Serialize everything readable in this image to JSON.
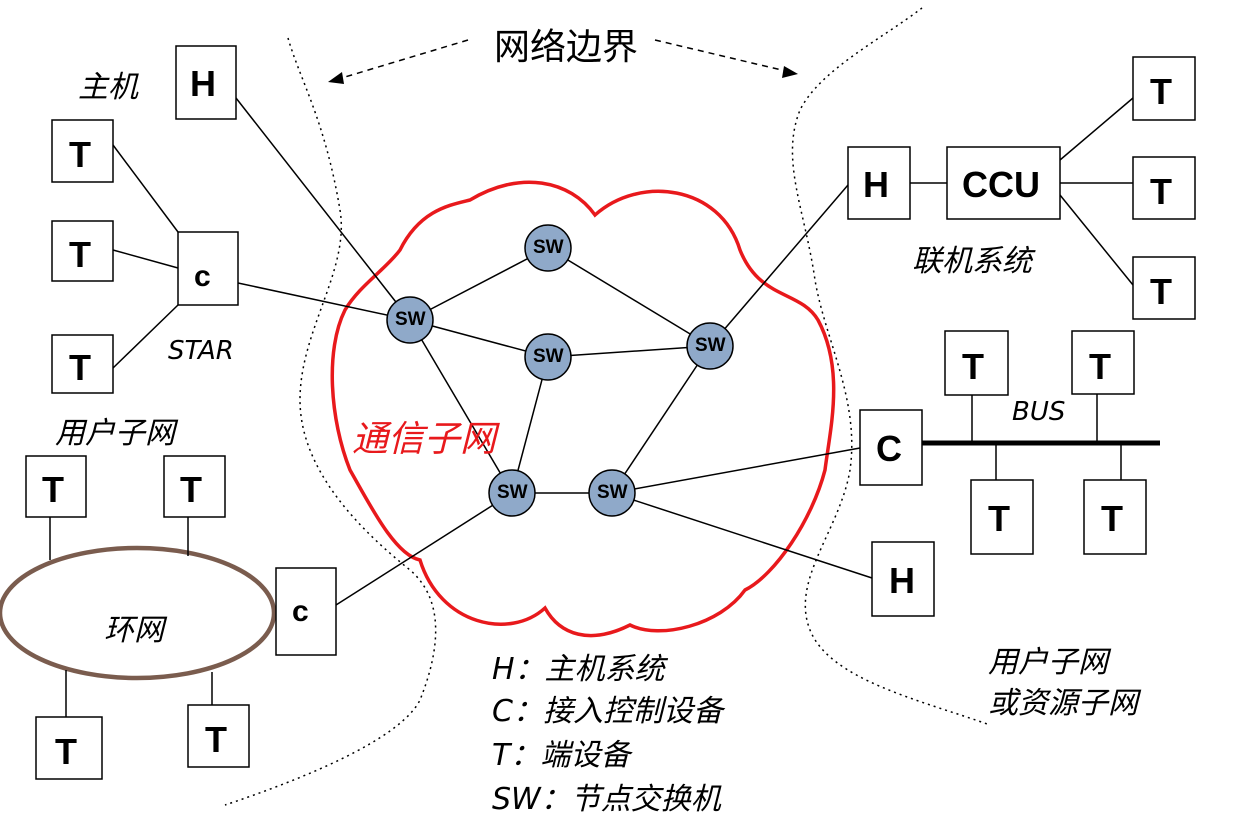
{
  "title": "网络边界",
  "labels": {
    "host_label": "主机",
    "star": "STAR",
    "user_subnet_left": "用户子网",
    "comm_subnet": "通信子网",
    "ring_label": "环网",
    "online_system": "联机系统",
    "bus": "BUS",
    "user_subnet_right_1": "用户子网",
    "user_subnet_right_2": "或资源子网"
  },
  "legend": [
    "H：主机系统",
    "C：接入控制设备",
    "T：端设备",
    "SW：节点交换机"
  ],
  "nodes": {
    "H": "H",
    "T": "T",
    "C": "C",
    "c": "c",
    "CCU": "CCU",
    "SW": "SW"
  },
  "colors": {
    "comm_subnet_border": "#e8191c",
    "switch_fill": "#8fa9c9",
    "ring_border": "#7a5c4e",
    "line": "#000000"
  }
}
